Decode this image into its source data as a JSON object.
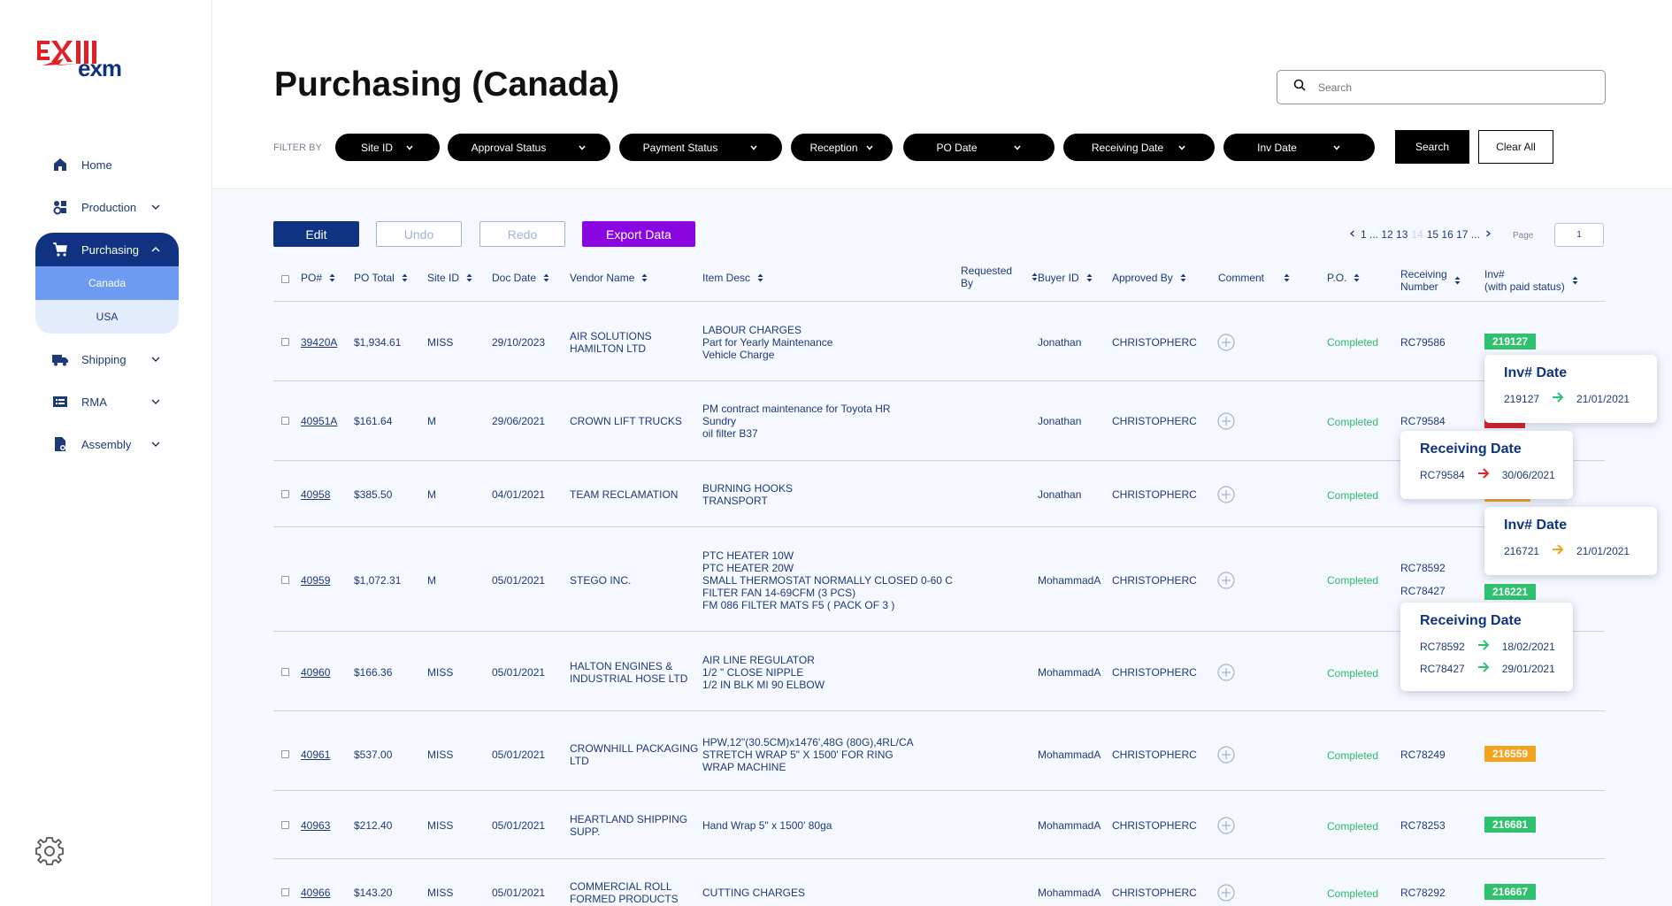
{
  "brand": {
    "name": "exm"
  },
  "sidebar": {
    "items": [
      {
        "label": "Home",
        "icon": "home-icon"
      },
      {
        "label": "Production",
        "icon": "production-icon"
      },
      {
        "label": "Purchasing",
        "icon": "cart-icon"
      },
      {
        "label": "Shipping",
        "icon": "truck-icon"
      },
      {
        "label": "RMA",
        "icon": "rma-icon"
      },
      {
        "label": "Assembly",
        "icon": "assembly-icon"
      }
    ],
    "purchasing_sub": [
      "Canada",
      "USA"
    ]
  },
  "header": {
    "title": "Purchasing (Canada)",
    "search_placeholder": "Search",
    "filter_label": "FILTER BY",
    "filters": [
      "Site ID",
      "Approval Status",
      "Payment Status",
      "Reception",
      "PO Date",
      "Receiving Date",
      "Inv Date"
    ],
    "search_button": "Search",
    "clear_button": "Clear All"
  },
  "toolbar": {
    "edit": "Edit",
    "undo": "Undo",
    "redo": "Redo",
    "export": "Export Data"
  },
  "pagination": {
    "pages_a": "1 ... 12 13",
    "current": "14",
    "pages_b": "15 16 17 ...",
    "page_label": "Page",
    "page_value": "1"
  },
  "table": {
    "columns": {
      "po": "PO#",
      "po_total": "PO Total",
      "site_id": "Site ID",
      "doc_date": "Doc Date",
      "vendor": "Vendor Name",
      "item_desc": "Item Desc",
      "requested_by_1": "Requested",
      "requested_by_2": "By",
      "buyer": "Buyer ID",
      "approved": "Approved By",
      "comment": "Comment",
      "po_status": "P.O.",
      "receiving_1": "Receiving",
      "receiving_2": "Number",
      "inv_1": "Inv#",
      "inv_2": "(with paid status)"
    },
    "rows": [
      {
        "po": "39420A",
        "total": "$1,934.61",
        "site": "MISS",
        "date": "29/10/2023",
        "vendor": [
          "AIR SOLUTIONS",
          "HAMILTON LTD"
        ],
        "desc": [
          "LABOUR CHARGES",
          "Part for Yearly Maintenance",
          "Vehicle Charge"
        ],
        "buyer": "Jonathan",
        "approved": "CHRISTOPHERC",
        "status": "Completed",
        "recv": [
          "RC79586"
        ],
        "inv": [
          "219127"
        ]
      },
      {
        "po": "40951A",
        "total": "$161.64",
        "site": "M",
        "date": "29/06/2021",
        "vendor": [
          "CROWN LIFT TRUCKS"
        ],
        "desc": [
          "PM contract maintenance for Toyota HR",
          "Sundry",
          "oil filter B37"
        ],
        "buyer": "Jonathan",
        "approved": "CHRISTOPHERC",
        "status": "Completed",
        "recv": [
          "RC79584"
        ],
        "inv": [
          ""
        ]
      },
      {
        "po": "40958",
        "total": "$385.50",
        "site": "M",
        "date": "04/01/2021",
        "vendor": [
          "TEAM RECLAMATION"
        ],
        "desc": [
          "BURNING HOOKS",
          "TRANSPORT"
        ],
        "buyer": "Jonathan",
        "approved": "CHRISTOPHERC",
        "status": "Completed",
        "recv": [
          ""
        ],
        "inv": [
          ""
        ]
      },
      {
        "po": "40959",
        "total": "$1,072.31",
        "site": "M",
        "date": "05/01/2021",
        "vendor": [
          "STEGO INC."
        ],
        "desc": [
          "PTC HEATER 10W",
          "PTC HEATER 20W",
          "SMALL THERMOSTAT NORMALLY CLOSED 0-60 C",
          "FILTER FAN 14-69CFM (3 PCS)",
          "FM 086 FILTER MATS F5 ( PACK OF 3 )"
        ],
        "buyer": "MohammadA",
        "approved": "CHRISTOPHERC",
        "status": "Completed",
        "recv": [
          "RC78592",
          "RC78427"
        ],
        "inv": [
          "216221"
        ]
      },
      {
        "po": "40960",
        "total": "$166.36",
        "site": "MISS",
        "date": "05/01/2021",
        "vendor": [
          "HALTON ENGINES &",
          "INDUSTRIAL HOSE LTD"
        ],
        "desc": [
          "AIR LINE REGULATOR",
          "1/2 \" CLOSE NIPPLE",
          "1/2 IN BLK MI 90 ELBOW"
        ],
        "buyer": "MohammadA",
        "approved": "CHRISTOPHERC",
        "status": "Completed",
        "recv": [
          ""
        ],
        "inv": [
          ""
        ]
      },
      {
        "po": "40961",
        "total": "$537.00",
        "site": "MISS",
        "date": "05/01/2021",
        "vendor": [
          "CROWNHILL PACKAGING",
          "LTD"
        ],
        "desc": [
          "HPW,12\"(30.5CM)x1476',48G (80G),4RL/CA",
          "STRETCH WRAP 5\" X 1500' FOR RING",
          "WRAP MACHINE"
        ],
        "buyer": "MohammadA",
        "approved": "CHRISTOPHERC",
        "status": "Completed",
        "recv": [
          "RC78249"
        ],
        "inv": [
          "216559"
        ]
      },
      {
        "po": "40963",
        "total": "$212.40",
        "site": "MISS",
        "date": "05/01/2021",
        "vendor": [
          "HEARTLAND SHIPPING",
          "SUPP."
        ],
        "desc": [
          "Hand Wrap 5\" x 1500' 80ga"
        ],
        "buyer": "MohammadA",
        "approved": "CHRISTOPHERC",
        "status": "Completed",
        "recv": [
          "RC78253"
        ],
        "inv": [
          "216681"
        ]
      },
      {
        "po": "40966",
        "total": "$143.20",
        "site": "MISS",
        "date": "05/01/2021",
        "vendor": [
          "COMMERCIAL ROLL",
          "FORMED PRODUCTS"
        ],
        "desc": [
          "CUTTING CHARGES"
        ],
        "buyer": "MohammadA",
        "approved": "CHRISTOPHERC",
        "status": "Completed",
        "recv": [
          "RC78292"
        ],
        "inv": [
          "216667"
        ]
      }
    ]
  },
  "tooltips": [
    {
      "title": "Inv# Date",
      "rows": [
        {
          "a": "219127",
          "arrow": "green",
          "b": "21/01/2021"
        }
      ]
    },
    {
      "title": "Receiving Date",
      "rows": [
        {
          "a": "RC79584",
          "arrow": "red",
          "b": "30/06/2021"
        }
      ]
    },
    {
      "title": "Inv# Date",
      "rows": [
        {
          "a": "216721",
          "arrow": "orange",
          "b": "21/01/2021"
        }
      ]
    },
    {
      "title": "Receiving Date",
      "rows": [
        {
          "a": "RC78592",
          "arrow": "green",
          "b": "18/02/2021"
        },
        {
          "a": "RC78427",
          "arrow": "green",
          "b": "29/01/2021"
        }
      ]
    }
  ],
  "colors": {
    "navy": "#0f3381",
    "accent": "#8a06e0",
    "completed": "#2db86b",
    "badge_green": "#2ec26f",
    "badge_orange": "#f4a31d",
    "badge_red": "#d8252b"
  }
}
